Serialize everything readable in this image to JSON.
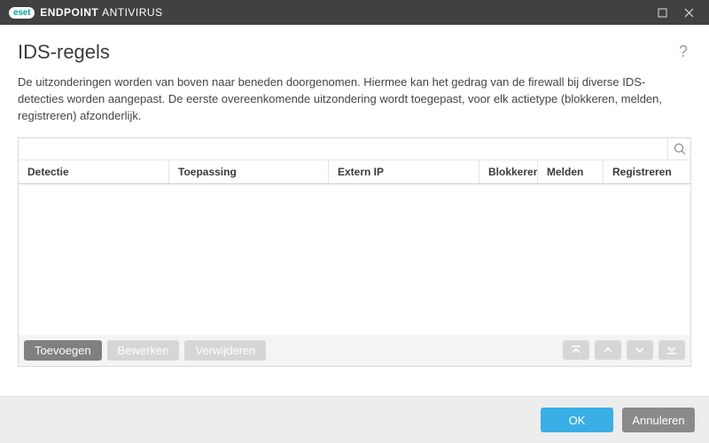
{
  "brand": {
    "badge": "eset",
    "bold": "ENDPOINT",
    "light": "ANTIVIRUS"
  },
  "page": {
    "title": "IDS-regels",
    "help": "?",
    "description": "De uitzonderingen worden van boven naar beneden doorgenomen. Hiermee kan het gedrag van de firewall bij diverse IDS-detecties worden aangepast. De eerste overeenkomende uitzondering wordt toegepast, voor elk actietype (blokkeren, melden, registreren) afzonderlijk."
  },
  "search": {
    "placeholder": ""
  },
  "columns": {
    "detection": "Detectie",
    "application": "Toepassing",
    "extern_ip": "Extern IP",
    "block": "Blokkeren",
    "notify": "Melden",
    "register": "Registreren"
  },
  "rows": [],
  "table_actions": {
    "add": "Toevoegen",
    "edit": "Bewerken",
    "delete": "Verwijderen"
  },
  "dialog": {
    "ok": "OK",
    "cancel": "Annuleren"
  }
}
